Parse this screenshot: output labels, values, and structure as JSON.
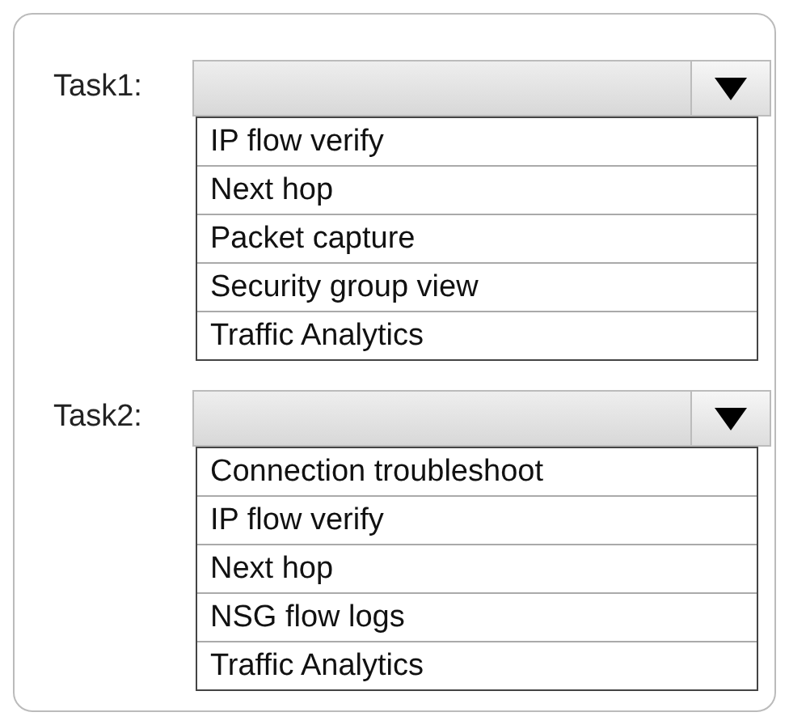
{
  "tasks": [
    {
      "label": "Task1:",
      "options": [
        "IP flow verify",
        "Next hop",
        "Packet capture",
        "Security group view",
        "Traffic Analytics"
      ]
    },
    {
      "label": "Task2:",
      "options": [
        "Connection troubleshoot",
        "IP flow verify",
        "Next hop",
        "NSG flow logs",
        "Traffic Analytics"
      ]
    }
  ]
}
